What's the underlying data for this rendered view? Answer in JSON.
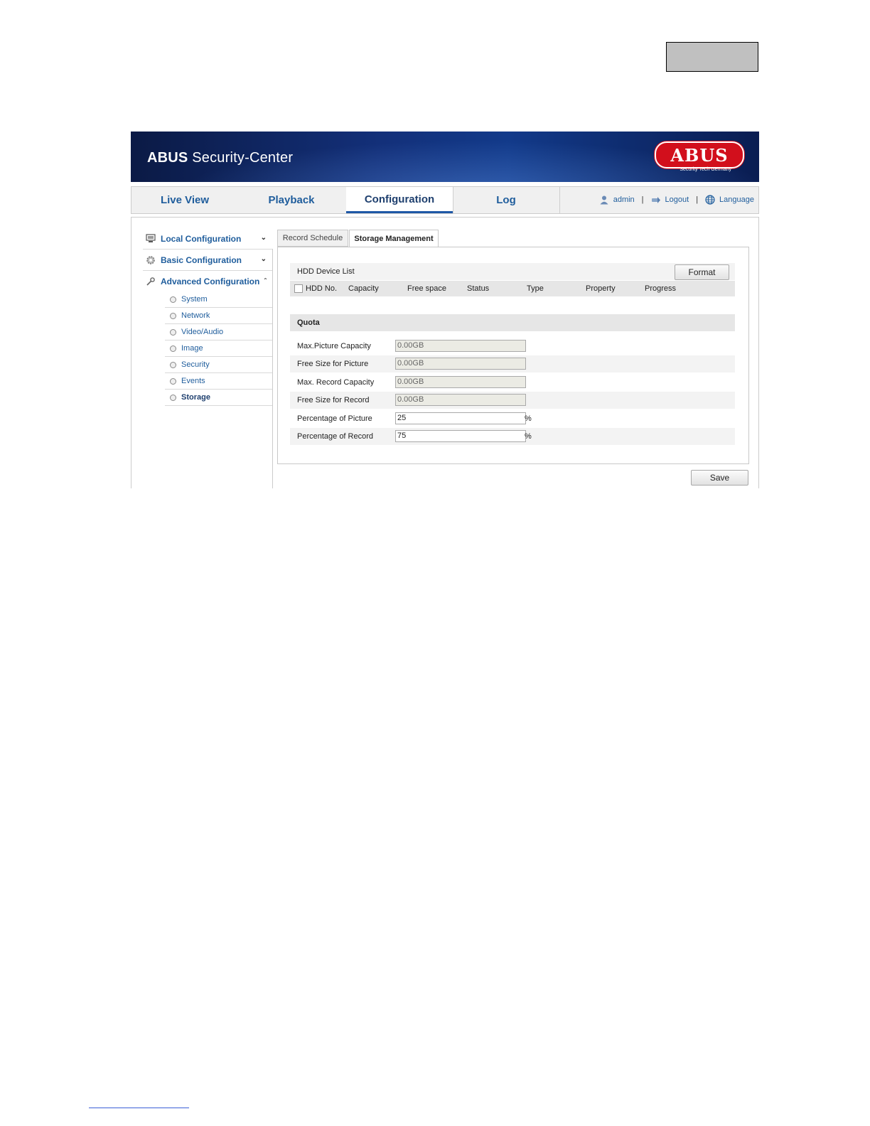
{
  "header": {
    "brand_bold": "ABUS",
    "brand_rest": " Security-Center",
    "logo_text": "ABUS",
    "logo_tagline": "Security Tech Germany"
  },
  "nav": {
    "tabs": [
      "Live View",
      "Playback",
      "Configuration",
      "Log"
    ],
    "active_tab": "Configuration",
    "user": "admin",
    "logout": "Logout",
    "language": "Language",
    "separator": "|"
  },
  "sidebar": {
    "sections": [
      {
        "label": "Local Configuration",
        "icon": "monitor-icon",
        "expanded": false
      },
      {
        "label": "Basic Configuration",
        "icon": "gear-icon",
        "expanded": false
      },
      {
        "label": "Advanced Configuration",
        "icon": "wrench-icon",
        "expanded": true
      }
    ],
    "items": [
      "System",
      "Network",
      "Video/Audio",
      "Image",
      "Security",
      "Events",
      "Storage"
    ],
    "active_item": "Storage"
  },
  "subtabs": [
    "Record Schedule",
    "Storage Management"
  ],
  "active_subtab": "Storage Management",
  "hdd": {
    "title": "HDD Device List",
    "format_button": "Format",
    "columns": [
      "HDD No.",
      "Capacity",
      "Free space",
      "Status",
      "Type",
      "Property",
      "Progress"
    ]
  },
  "quota": {
    "title": "Quota",
    "rows": [
      {
        "label": "Max.Picture Capacity",
        "value": "0.00GB",
        "unit": ""
      },
      {
        "label": "Free Size for Picture",
        "value": "0.00GB",
        "unit": ""
      },
      {
        "label": "Max. Record Capacity",
        "value": "0.00GB",
        "unit": ""
      },
      {
        "label": "Free Size for Record",
        "value": "0.00GB",
        "unit": ""
      },
      {
        "label": "Percentage of Picture",
        "value": "25",
        "unit": "%"
      },
      {
        "label": "Percentage of Record",
        "value": "75",
        "unit": "%"
      }
    ]
  },
  "save_button": "Save",
  "colors": {
    "accent": "#1f5d9c",
    "banner": "#13307a",
    "logo_red": "#d20f1c"
  }
}
